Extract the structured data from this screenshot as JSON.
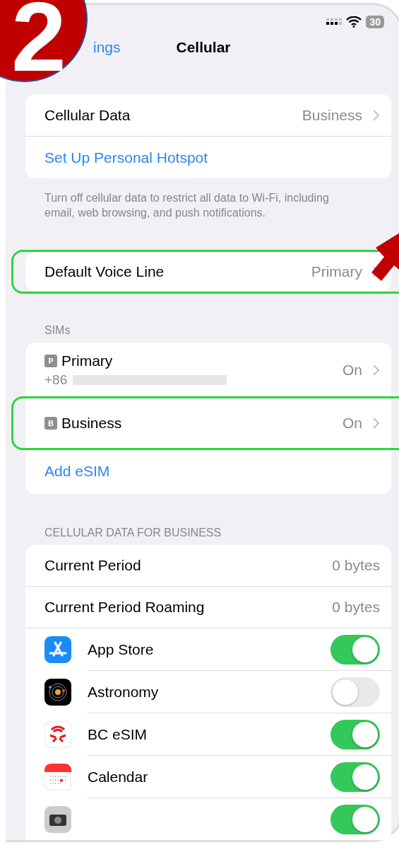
{
  "status_bar": {
    "battery": "30"
  },
  "nav": {
    "back": "ings",
    "title": "Cellular"
  },
  "data_group": {
    "rows": [
      {
        "kind": "value",
        "label": "Cellular Data",
        "value": "Business"
      },
      {
        "kind": "link",
        "label": "Set Up Personal Hotspot"
      }
    ],
    "footer": "Turn off cellular data to restrict all data to Wi-Fi, including email, web browsing, and push notifications."
  },
  "voice_group": {
    "rows": [
      {
        "label": "Default Voice Line",
        "value": "Primary",
        "highlighted": true
      }
    ]
  },
  "sims": {
    "header": "SIMs",
    "rows": [
      {
        "kind": "sim",
        "badge": "P",
        "label": "Primary",
        "subtitle": "+86",
        "value": "On"
      },
      {
        "kind": "sim",
        "badge": "B",
        "label": "Business",
        "value": "On",
        "highlighted": true
      },
      {
        "kind": "link",
        "label": "Add eSIM"
      }
    ]
  },
  "usage": {
    "header": "CELLULAR DATA FOR BUSINESS",
    "rows": [
      {
        "label": "Current Period",
        "value": "0 bytes"
      },
      {
        "label": "Current Period Roaming",
        "value": "0 bytes"
      }
    ],
    "apps": [
      {
        "kind": "appstore",
        "label": "App Store",
        "on": true
      },
      {
        "kind": "astronomy",
        "label": "Astronomy",
        "on": false
      },
      {
        "kind": "bcesim",
        "label": "BC eSIM",
        "on": true
      },
      {
        "kind": "calendar",
        "label": "Calendar",
        "on": true
      },
      {
        "kind": "camera",
        "on": true
      }
    ]
  },
  "annotation": {
    "step": "2"
  }
}
